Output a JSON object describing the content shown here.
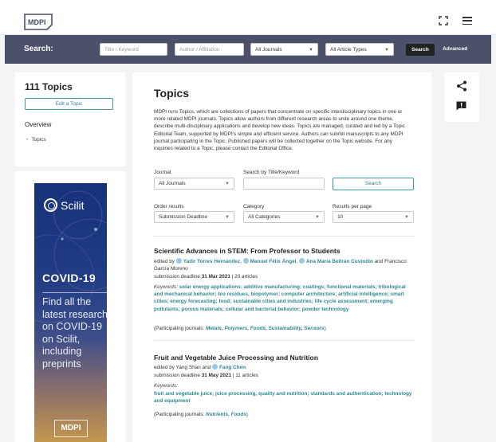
{
  "header": {
    "logo_text": "MDPI",
    "expand_icon": "expand-icon",
    "menu_icon": "hamburger-menu-icon"
  },
  "searchbar": {
    "label": "Search:",
    "title_placeholder": "Title / Keyword",
    "author_placeholder": "Author / Affiliation",
    "journals_value": "All Journals",
    "article_types_value": "All Article Types",
    "search_button": "Search",
    "advanced_link": "Advanced"
  },
  "sidebar": {
    "topics_count": "111 Topics",
    "edit_button": "Edit a Topic",
    "overview_title": "Overview",
    "items": [
      {
        "label": "Topics"
      }
    ]
  },
  "ad": {
    "brand": "Scilit",
    "headline": "COVID-19",
    "body": "Find all the latest research on COVID-19 on Scilit, including preprints",
    "footer_logo": "MDPI"
  },
  "main": {
    "title": "Topics",
    "description": "MDPI runs Topics, which are collections of papers that concentrate on specific interdisciplinary topics in one or more related MDPI journals. Topics allow authors from different research areas to unite around one theme, describe multi-disciplinary applications and develop new ideas. Topics are managed, curated and led by a Topic Editorial Team, supported by MDPI's simple and efficient service. Authors can submit manuscripts to any MDPI journal participating in the Topic. Published papers will be collected together on the Topic website. For any inquiries related to a Topic, please contact the Editorial Office.",
    "filters": {
      "journal_label": "Journal",
      "journal_value": "All Journals",
      "search_label": "Search by Title/Keyword",
      "search_value": "",
      "search_button": "Search",
      "order_label": "Order results",
      "order_value": "Submission Deadline",
      "category_label": "Category",
      "category_value": "All Categories",
      "rpp_label": "Results per page",
      "rpp_value": "10"
    },
    "articles": [
      {
        "title": "Scientific Advances in STEM: From Professor to Students",
        "edited_by": "edited by",
        "authors": [
          "Yadir Torres Hernández",
          "Manuel Félix Ángel",
          "Ana María Beltrán Custodio"
        ],
        "and": "and",
        "extra_author": "Francisco García Moreno",
        "deadline_prefix": "submission deadline",
        "deadline": "31 Mar 2021",
        "count": "| 20 articles",
        "keywords_label": "Keywords:",
        "keywords": "solar energy applications; additive manufacturing; coatings; functional materials; tribological and mechanical behavior; bio residues, biopolymer; computer architecture; artificial intelligence; smart cities; energy forecasting; food; sustainable cities and industries; life cycle assessment; emerging pollutants; porous materials; cellular and bacterial behavior; powder technology",
        "participating_prefix": "(Participating journals:",
        "journals": "Metals, Polymers, Foods, Sustainability, Sensors",
        "participating_suffix": ")"
      },
      {
        "title": "Fruit and Vegetable Juice Processing and Nutrition",
        "edited_by": "edited by",
        "plain_author": "Yang Shan",
        "and": "and",
        "authors": [
          "Fang Chen"
        ],
        "deadline_prefix": "submission deadline",
        "deadline": "31 May 2021",
        "count": "| 11 articles",
        "keywords_label": "Keywords:",
        "keywords": "fruit and vegetable juice; juice processing, quality and nutrition; standards and authentication; technology and equipment",
        "participating_prefix": "(Participating journals:",
        "journals": "Nutrients, Foods",
        "participating_suffix": ")"
      }
    ]
  },
  "rightbar": {
    "share_icon": "share-icon",
    "report_icon": "report-icon"
  }
}
